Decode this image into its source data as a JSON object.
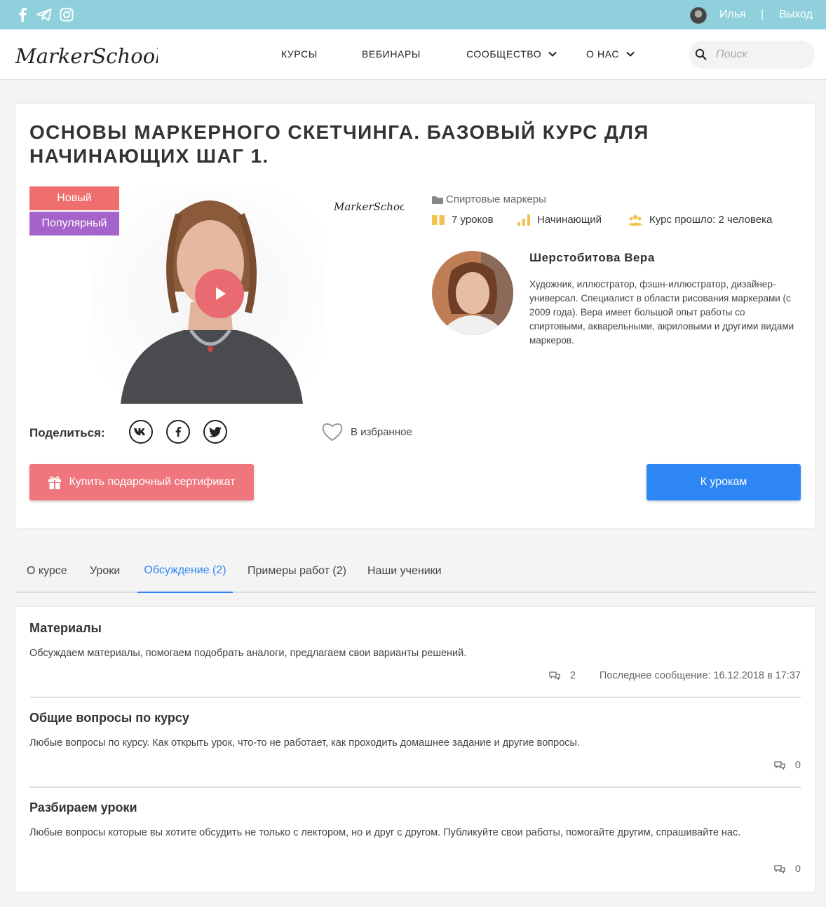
{
  "topbar": {
    "social": [
      "facebook-icon",
      "telegram-icon",
      "instagram-icon"
    ],
    "user_name": "Илья",
    "separator": "|",
    "logout": "Выход"
  },
  "header": {
    "logo_text": "MarkerSchool",
    "nav": {
      "courses": "КУРСЫ",
      "webinars": "ВЕБИНАРЫ",
      "community": "СООБЩЕСТВО",
      "about": "О НАС"
    },
    "search_placeholder": "Поиск"
  },
  "course": {
    "title": "Основы маркерного скетчинга. Базовый курс для начинающих шаг 1.",
    "badges": {
      "new": "Новый",
      "popular": "Популярный"
    },
    "category": "Спиртовые маркеры",
    "lessons": "7 уроков",
    "level": "Начинающий",
    "completed": "Курс прошло: 2 человека",
    "author": {
      "name": "Шерстобитова Вера",
      "bio": "Художник, иллюстратор, фэшн-иллюстратор, дизайнер-универсал. Специалист в области рисования маркерами (с 2009 года). Вера имеет большой опыт работы со спиртовыми, акварельными, акриловыми и другими видами маркеров."
    },
    "share_label": "Поделиться:",
    "favorite": "В избранное",
    "gift_button": "Купить подарочный сертификат",
    "lessons_button": "К урокам"
  },
  "tabs": {
    "about": "О курсе",
    "lessons": "Уроки",
    "discussion": "Обсуждение (2)",
    "examples": "Примеры работ (2)",
    "students": "Наши ученики"
  },
  "topics": [
    {
      "title": "Материалы",
      "desc": "Обсуждаем материалы, помогаем подобрать аналоги, предлагаем свои варианты решений.",
      "count": "2",
      "last": "Последнее сообщение: 16.12.2018 в 17:37"
    },
    {
      "title": "Общие вопросы по курсу",
      "desc": "Любые вопросы по курсу. Как открыть урок, что-то не работает, как проходить домашнее задание и другие вопросы.",
      "count": "0"
    },
    {
      "title": "Разбираем уроки",
      "desc": "Любые вопросы которые вы хотите обсудить не только с лектором, но и друг с другом. Публикуйте свои работы, помогайте другим, спрашивайте нас.",
      "count": "0"
    }
  ],
  "colors": {
    "topbar": "#8fd0dc",
    "badge_new": "#ef6f6f",
    "badge_popular": "#a663c9",
    "gift_button": "#ee767c",
    "primary_button": "#2e86f5",
    "meta_icons": "#f2c14e"
  }
}
